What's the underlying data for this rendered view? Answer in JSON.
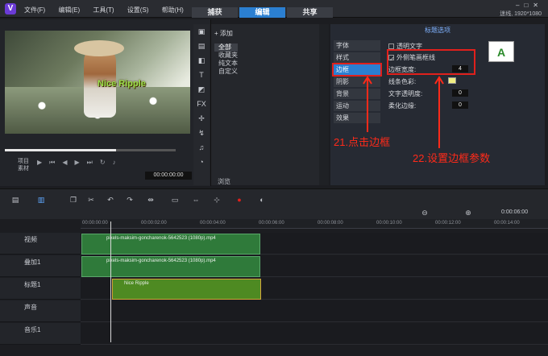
{
  "menu": [
    "文件(F)",
    "编辑(E)",
    "工具(T)",
    "设置(S)",
    "帮助(H)"
  ],
  "tabs": [
    "捕获",
    "编辑",
    "共享"
  ],
  "resolution": "迷线, 1920*1080",
  "preview": {
    "title_overlay": "Nice Ripple",
    "project_label": "项目",
    "clip_label": "素材",
    "timecode": "00:00:00:00"
  },
  "library": {
    "add": "添加",
    "items": [
      "全部",
      "收藏夹",
      "纯文本",
      "自定义"
    ],
    "browse": "浏览"
  },
  "options": {
    "header": "标题选项",
    "tabs": [
      "字体",
      "样式",
      "边框",
      "阴影",
      "背景",
      "运动",
      "效果"
    ],
    "active_tab": "边框",
    "transparent_text": "透明文字",
    "outer_stroke": "外侧笔画框线",
    "border_width": "边框宽度:",
    "border_width_val": "4",
    "line_color": "线条色彩:",
    "text_opacity": "文字透明度:",
    "text_opacity_val": "0",
    "soft_edge": "柔化边缘:",
    "soft_edge_val": "0",
    "sample": "A",
    "annotation1": "21.点击边框",
    "annotation2": "22.设置边框参数",
    "colors": {
      "accent": "#2b7fd1",
      "annotation": "#ff2a1a",
      "swatch": "#f0ee82"
    }
  },
  "timeline": {
    "ticks": [
      "00:00:00:00",
      "00:00:02:00",
      "00:00:04:00",
      "00:00:06:00",
      "00:00:08:00",
      "00:00:10:00",
      "00:00:12:00",
      "00:00:14:00"
    ],
    "end_time": "0:00:06:00",
    "tracks": [
      "视频",
      "叠加1",
      "标题1",
      "声音",
      "音乐1"
    ],
    "clips": [
      "pixels-maksim-goncharenok-5642523 (1080p).mp4",
      "pixels-maksim-goncharenok-5642523 (1080p).mp4",
      "Nice Ripple"
    ]
  }
}
